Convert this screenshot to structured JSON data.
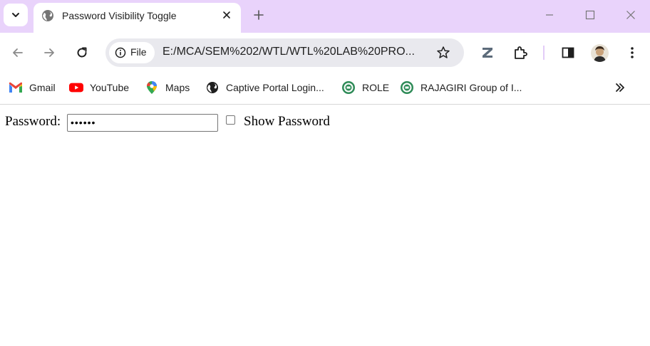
{
  "browser": {
    "tab": {
      "title": "Password Visibility Toggle"
    },
    "address_bar": {
      "chip_label": "File",
      "url": "E:/MCA/SEM%202/WTL/WTL%20LAB%20PRO..."
    },
    "bookmarks": [
      {
        "label": "Gmail",
        "icon": "gmail-icon"
      },
      {
        "label": "YouTube",
        "icon": "youtube-icon"
      },
      {
        "label": "Maps",
        "icon": "maps-icon"
      },
      {
        "label": "Captive Portal Login...",
        "icon": "globe-icon"
      },
      {
        "label": "ROLE",
        "icon": "rajagiri-icon"
      },
      {
        "label": "RAJAGIRI Group of I...",
        "icon": "rajagiri-icon"
      }
    ],
    "colors": {
      "titlebar": "#e9d3fb",
      "omnibox": "#e9e9ee"
    }
  },
  "page": {
    "password_label": "Password:",
    "password_value": "••••••",
    "show_password_label": "Show Password",
    "show_password_checked": false
  }
}
